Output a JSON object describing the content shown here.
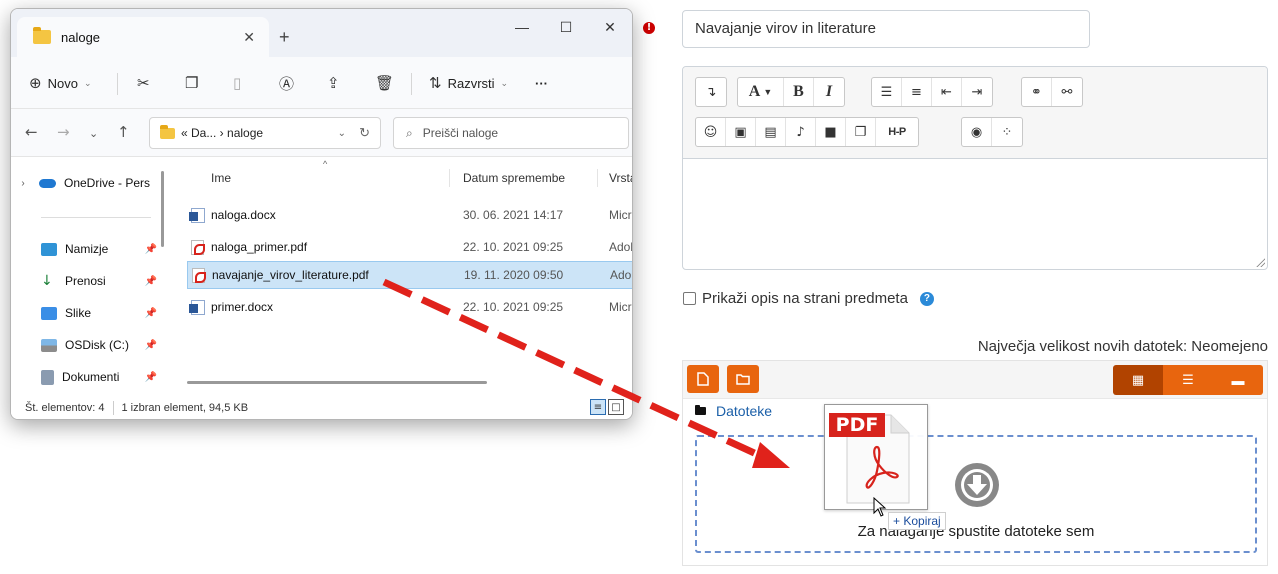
{
  "form": {
    "name_value": "Navajanje virov in literature",
    "show_description_label": "Prikaži opis na strani predmeta",
    "max_size_text": "Največja velikost novih datotek: Neomejeno",
    "path_label": "Datoteke",
    "drop_text": "Za nalaganje spustite datoteke sem",
    "toolbar_labels": {
      "bold": "B",
      "italic": "I",
      "h5p": "H-P",
      "font": "A"
    }
  },
  "drag": {
    "file_badge": "PDF",
    "copy_label": "+ Kopiraj"
  },
  "explorer": {
    "tab_title": "naloge",
    "new_tab": "+",
    "commands": {
      "new": "Novo",
      "sort": "Razvrsti",
      "more": "···"
    },
    "address": "« Da... › naloge",
    "search_placeholder": "Preišči naloge",
    "nav": [
      {
        "label": "OneDrive - Pers",
        "icon": "cloud-icon"
      },
      {
        "label": "Namizje",
        "icon": "desktop-icon"
      },
      {
        "label": "Prenosi",
        "icon": "download-icon"
      },
      {
        "label": "Slike",
        "icon": "pictures-icon"
      },
      {
        "label": "OSDisk (C:)",
        "icon": "drive-icon"
      },
      {
        "label": "Dokumenti",
        "icon": "documents-icon"
      }
    ],
    "columns": {
      "name": "Ime",
      "date": "Datum spremembe",
      "type": "Vrsta"
    },
    "files": [
      {
        "name": "naloga.docx",
        "date": "30. 06. 2021 14:17",
        "type": "Micros",
        "icon": "word-icon"
      },
      {
        "name": "naloga_primer.pdf",
        "date": "22. 10. 2021 09:25",
        "type": "Adobe",
        "icon": "pdf-icon"
      },
      {
        "name": "navajanje_virov_literature.pdf",
        "date": "19. 11. 2020 09:50",
        "type": "Adobe",
        "icon": "pdf-icon"
      },
      {
        "name": "primer.docx",
        "date": "22. 10. 2021 09:25",
        "type": "Micros",
        "icon": "word-icon"
      }
    ],
    "status": {
      "count": "Št. elementov: 4",
      "selected": "1 izbran element, 94,5 KB"
    }
  },
  "colors": {
    "accent_orange": "#e8650e",
    "accent_dark": "#b14300",
    "drag_arrow": "#e0221b",
    "selection": "#cce4f7",
    "link": "#1b5fa8"
  }
}
